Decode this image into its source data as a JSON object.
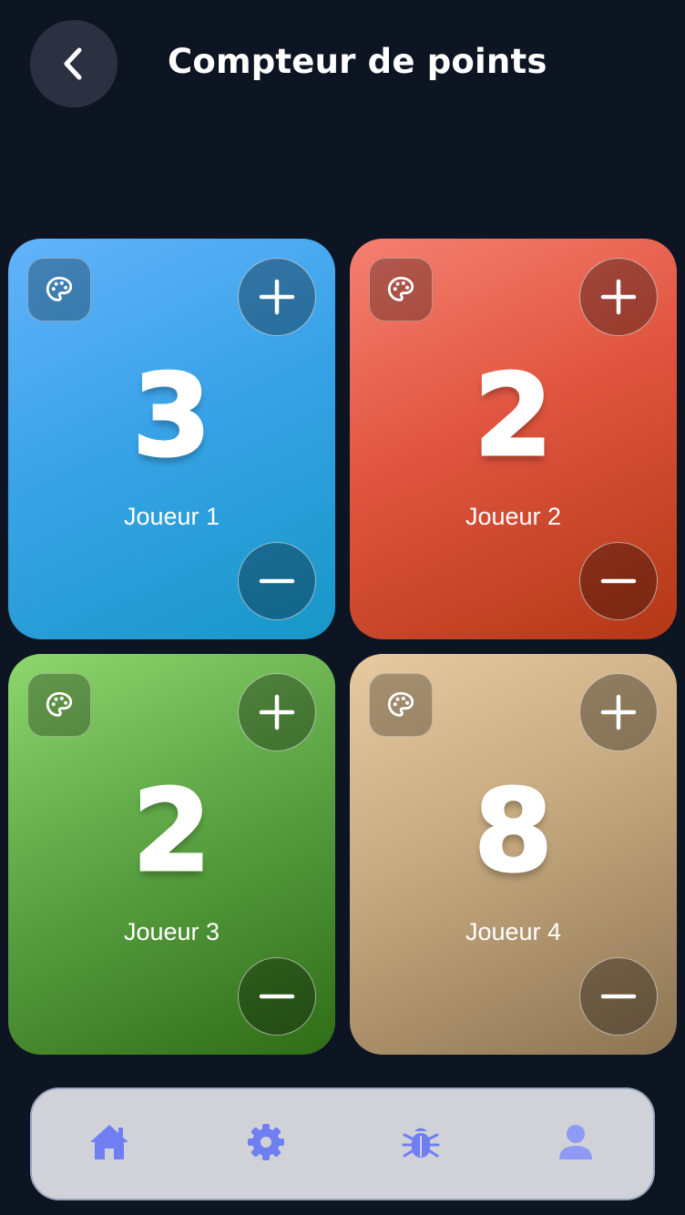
{
  "header": {
    "title": "Compteur de points",
    "back_icon": "chevron-left-icon"
  },
  "players": [
    {
      "name": "Joueur 1",
      "score": "3",
      "color": "#3aa3e8"
    },
    {
      "name": "Joueur 2",
      "score": "2",
      "color": "#e0553f"
    },
    {
      "name": "Joueur 3",
      "score": "2",
      "color": "#5da545"
    },
    {
      "name": "Joueur 4",
      "score": "8",
      "color": "#c5a87e"
    }
  ],
  "card_icons": {
    "palette": "palette-icon",
    "increment": "plus-icon",
    "decrement": "minus-icon"
  },
  "navbar": {
    "items": [
      {
        "icon": "home-icon"
      },
      {
        "icon": "gear-icon"
      },
      {
        "icon": "bug-icon"
      },
      {
        "icon": "user-icon"
      }
    ],
    "icon_color": "#6f7ff3"
  }
}
